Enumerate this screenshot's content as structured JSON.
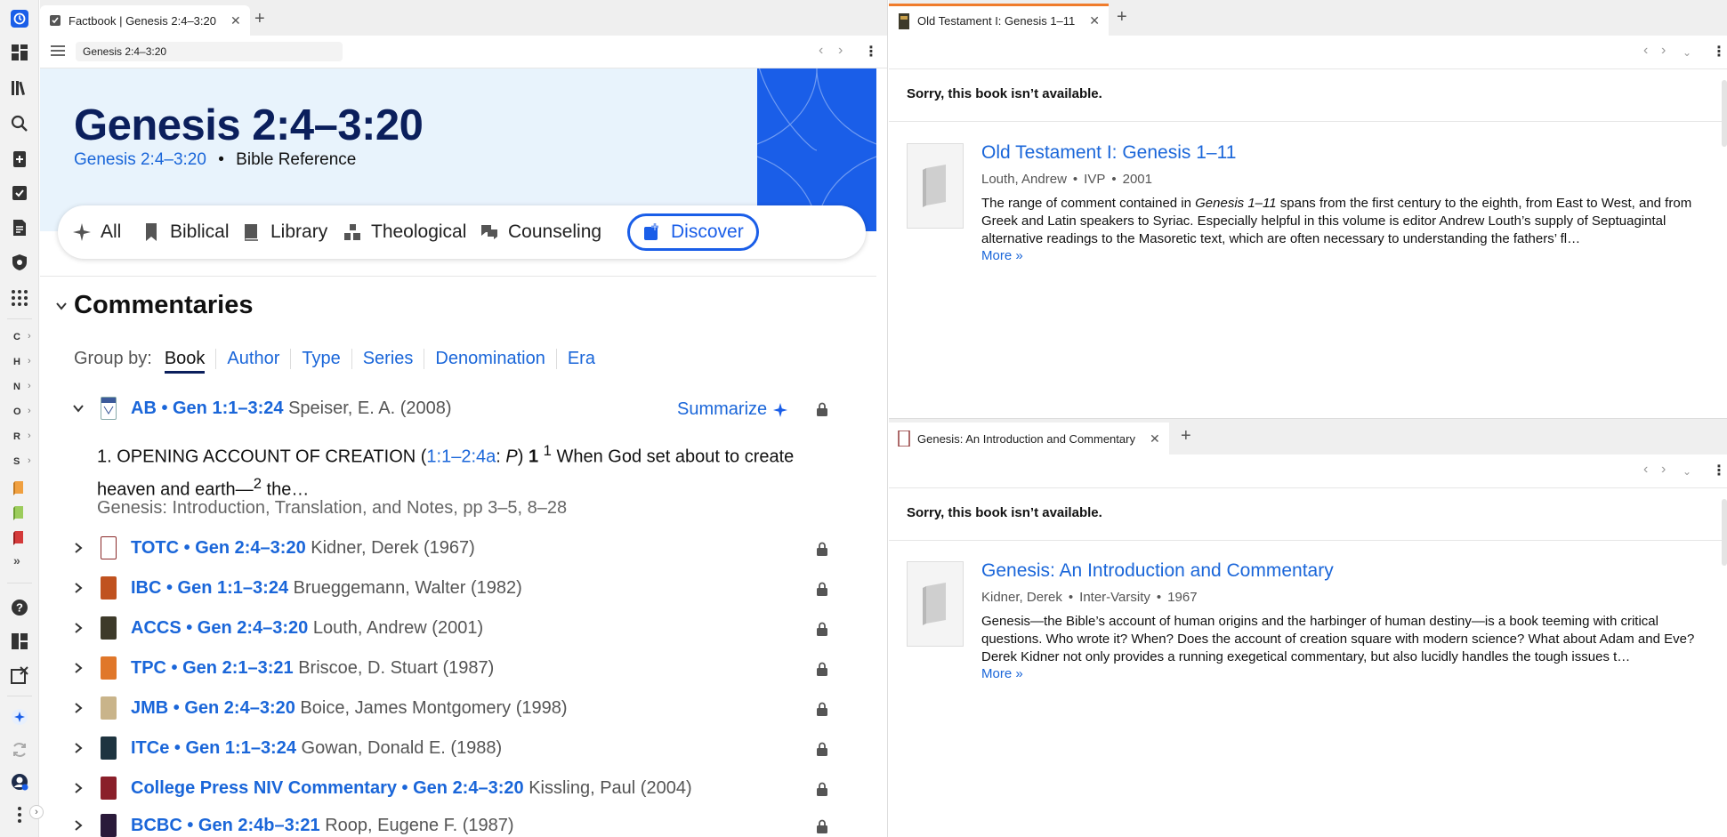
{
  "rail": {
    "letters": [
      "C",
      "H",
      "N",
      "O",
      "R",
      "S"
    ]
  },
  "paneA": {
    "tab_label": "Factbook | Genesis 2:4–3:20",
    "address": "Genesis 2:4–3:20",
    "title": "Genesis 2:4–3:20",
    "subtitle_link": "Genesis 2:4–3:20",
    "subtitle_sep": "•",
    "subtitle_type": "Bible Reference",
    "filters": [
      "All",
      "Biblical",
      "Library",
      "Theological",
      "Counseling",
      "Discover"
    ],
    "section_title": "Commentaries",
    "group_by_label": "Group by:",
    "group_by": [
      "Book",
      "Author",
      "Type",
      "Series",
      "Denomination",
      "Era"
    ],
    "summarize": "Summarize",
    "excerpt": {
      "pre": "1. OPENING ACCOUNT OF CREATION (",
      "link": "1:1–2:4a",
      "mid": ": ",
      "italic": "P",
      "post": ") ",
      "bold": "1",
      "sup1": "1",
      "text1": " When God set about to create heaven and earth—",
      "sup2": "2",
      "text2": " the…",
      "source": "Genesis: Introduction, Translation, and Notes, pp 3–5, 8–28"
    },
    "rows": [
      {
        "abbr": "AB • Gen 1:1–3:24",
        "author": "Speiser, E. A. (2008)"
      },
      {
        "abbr": "TOTC • Gen 2:4–3:20",
        "author": "Kidner, Derek (1967)"
      },
      {
        "abbr": "IBC • Gen 1:1–3:24",
        "author": "Brueggemann, Walter (1982)"
      },
      {
        "abbr": "ACCS • Gen 2:4–3:20",
        "author": "Louth, Andrew (2001)"
      },
      {
        "abbr": "TPC • Gen 2:1–3:21",
        "author": "Briscoe, D. Stuart (1987)"
      },
      {
        "abbr": "JMB • Gen 2:4–3:20",
        "author": "Boice, James Montgomery (1998)"
      },
      {
        "abbr": "ITCe • Gen 1:1–3:24",
        "author": "Gowan, Donald E. (1988)"
      },
      {
        "abbr": "College Press NIV Commentary • Gen 2:4–3:20",
        "author": "Kissling, Paul (2004)"
      },
      {
        "abbr": "BCBC • Gen 2:4b–3:21",
        "author": "Roop, Eugene F. (1987)"
      }
    ]
  },
  "paneB": {
    "tab_label": "Old Testament I: Genesis 1–11",
    "sorry": "Sorry, this book isn’t available.",
    "book_title": "Old Testament I: Genesis 1–11",
    "meta": [
      "Louth, Andrew",
      "IVP",
      "2001"
    ],
    "desc_pre": "The range of comment contained in ",
    "desc_italic": "Genesis 1–11",
    "desc_post": " spans from the first century to the eighth, from East to West, and from Greek and Latin speakers to Syriac. Especially helpful in this volume is editor Andrew Louth’s supply of Septuagintal alternative readings to the Masoretic text, which are often necessary to understanding the fathers’ fl…",
    "more": "More »"
  },
  "paneC": {
    "tab_label": "Genesis: An Introduction and Commentary",
    "sorry": "Sorry, this book isn’t available.",
    "book_title": "Genesis: An Introduction and Commentary",
    "meta": [
      "Kidner, Derek",
      "Inter-Varsity",
      "1967"
    ],
    "desc": "Genesis—the Bible’s account of human origins and the harbinger of human destiny—is a book teeming with critical questions. Who wrote it? When? Does the account of creation square with modern science? What about Adam and Eve? Derek Kidner not only provides a running exegetical commentary, but also lucidly handles the tough issues t…",
    "more": "More »"
  },
  "colors": {
    "accent": "#1a5ee8",
    "link": "#1a66d9",
    "title": "#0b1f5c",
    "hero_bg": "#e8f3fc",
    "tab_orange": "#f07c2c"
  }
}
